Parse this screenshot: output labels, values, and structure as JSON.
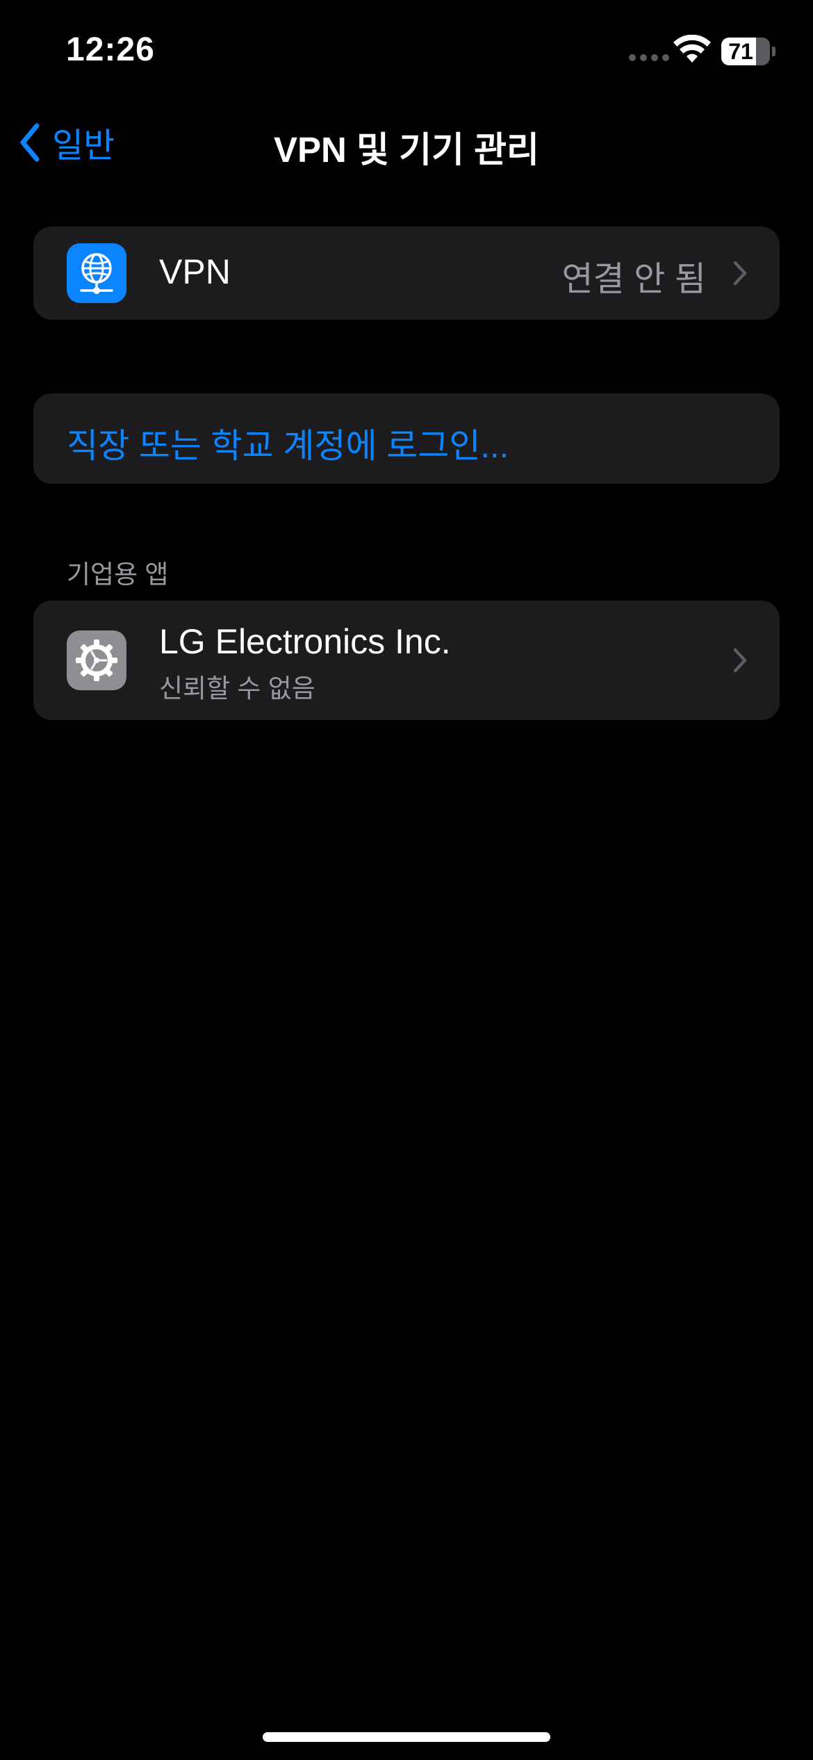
{
  "status_bar": {
    "time": "12:26",
    "battery_level": "71",
    "battery_fraction": 0.71
  },
  "nav": {
    "back_label": "일반",
    "title": "VPN 및 기기 관리"
  },
  "vpn": {
    "label": "VPN",
    "status": "연결 안 됨",
    "icon": "globe-network-icon",
    "icon_color": "#0a84ff"
  },
  "work_login": {
    "label": "직장 또는 학교 계정에 로그인..."
  },
  "enterprise_apps": {
    "header": "기업용 앱",
    "items": [
      {
        "title": "LG Electronics Inc.",
        "subtitle": "신뢰할 수 없음",
        "icon": "gear-icon",
        "icon_color": "#8e8e93"
      }
    ]
  },
  "colors": {
    "background": "#000000",
    "group_background": "#1c1c1e",
    "accent": "#0a84ff",
    "secondary_text": "#98989f"
  }
}
